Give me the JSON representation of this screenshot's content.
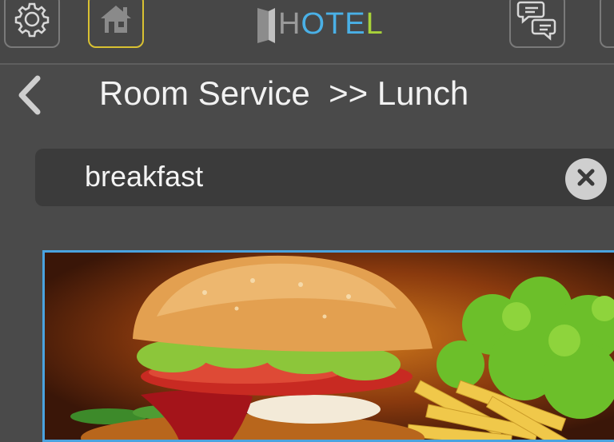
{
  "topbar": {
    "logo": {
      "text_gray": "H",
      "text_blue": "OTE",
      "text_green": "L"
    },
    "icons": {
      "settings": "gear-icon",
      "home": "home-icon",
      "chat": "chat-bubbles-icon"
    },
    "colors": {
      "home_border": "#d9c132",
      "logo_blue": "#4ab0e6",
      "logo_green": "#a8d23a"
    }
  },
  "nav": {
    "back_icon": "chevron-left-icon",
    "breadcrumb": "Room Service  >> Lunch"
  },
  "search": {
    "value": "breakfast",
    "clear_icon": "close-icon"
  },
  "content": {
    "card_border_color": "#4aa3df",
    "image": "burger-with-fries"
  }
}
